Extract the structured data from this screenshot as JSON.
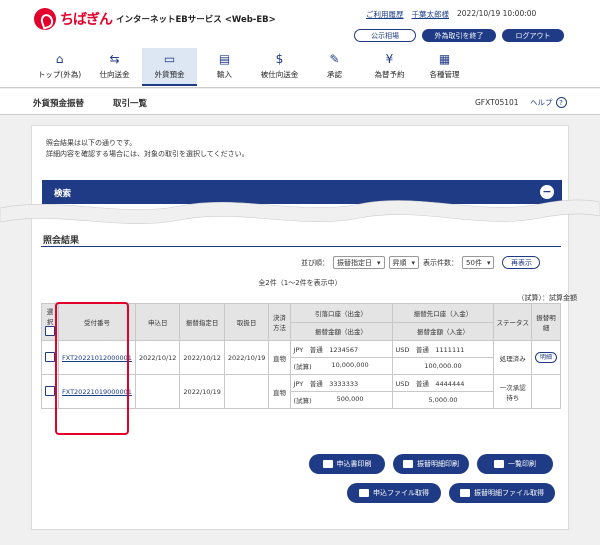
{
  "header": {
    "logo_name": "ちばぎん",
    "service_name": "インターネットEBサービス <Web-EB>",
    "history_link": "ご利用履歴",
    "user_name": "千葉太郎様",
    "timestamp": "2022/10/19 10:00:00",
    "notice_button": "公示相場",
    "end_fx_button": "外為取引を終了",
    "logout_button": "ログアウト"
  },
  "nav": [
    {
      "label": "トップ(外為)",
      "icon": "home-icon"
    },
    {
      "label": "仕向送金",
      "icon": "remit-icon"
    },
    {
      "label": "外貨預金",
      "icon": "deposit-icon"
    },
    {
      "label": "輸入",
      "icon": "import-icon"
    },
    {
      "label": "被仕向送金",
      "icon": "receive-icon"
    },
    {
      "label": "承認",
      "icon": "approve-icon"
    },
    {
      "label": "為替予約",
      "icon": "forex-icon"
    },
    {
      "label": "各種管理",
      "icon": "manage-icon"
    }
  ],
  "titlebar": {
    "section": "外貨預金振替",
    "page": "取引一覧",
    "code": "GFXT05101",
    "help": "ヘルプ",
    "help_glyph": "?"
  },
  "message": {
    "line1": "照会結果は以下の通りです。",
    "line2": "詳細内容を確認する場合には、対象の取引を選択してください。"
  },
  "search": {
    "title": "検索",
    "toggle": "−"
  },
  "results": {
    "title": "照会結果",
    "sort_label": "並び順：",
    "sort_value": "振替指定日",
    "order_value": "昇順",
    "per_page_label": "表示件数：",
    "per_page_value": "50件",
    "redisplay": "再表示",
    "count_text": "全2件（1～2件を表示中）",
    "unit_text": "（試算）：試算金額"
  },
  "table": {
    "headers": {
      "select": "選択",
      "receipt": "受付番号",
      "applied": "申込日",
      "transfer_date": "振替指定日",
      "handled": "取扱日",
      "method": "決済方法",
      "debit": "引落口座（出金）",
      "debit_amount": "振替金額（出金）",
      "credit": "振替先口座（入金）",
      "credit_amount": "振替金額（入金）",
      "status": "ステータス",
      "detail": "振替明細"
    },
    "rows": [
      {
        "receipt": "FXT20221012000001",
        "applied": "2022/10/12",
        "transfer_date": "2022/10/12",
        "handled": "2022/10/19",
        "method": "直物",
        "debit_account": "JPY　普通　1234567",
        "debit_amount_prefix": "(試算)",
        "debit_amount": "10,000,000",
        "credit_account": "USD　普通　1111111",
        "credit_amount_prefix": "",
        "credit_amount": "100,000.00",
        "status": "処理済み",
        "detail_button": "明細"
      },
      {
        "receipt": "FXT20221019000001",
        "applied": "",
        "transfer_date": "2022/10/19",
        "handled": "",
        "method": "直物",
        "debit_account": "JPY　普通　3333333",
        "debit_amount_prefix": "(試算)",
        "debit_amount": "500,000",
        "credit_account": "USD　普通　4444444",
        "credit_amount_prefix": "",
        "credit_amount": "5,000.00",
        "status": "一次承認待ち",
        "detail_button": ""
      }
    ]
  },
  "actions": {
    "print_application": "申込書印刷",
    "print_detail": "振替明細印刷",
    "print_list": "一覧印刷",
    "download_application": "申込ファイル取得",
    "download_detail": "振替明細ファイル取得"
  },
  "colors": {
    "brand_red": "#e4002b",
    "navy": "#1f3b85"
  }
}
